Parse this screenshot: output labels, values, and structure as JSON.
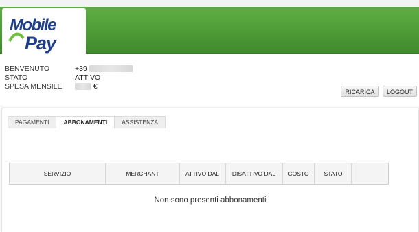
{
  "brand": {
    "logo_line1": "Mobile",
    "logo_line2": "Pay",
    "header_color": "#4e9b36"
  },
  "info": {
    "rows": [
      {
        "label": "BENVENUTO",
        "value": "+39"
      },
      {
        "label": "STATO",
        "value": "ATTIVO"
      },
      {
        "label": "SPESA MENSILE",
        "value": "€"
      }
    ]
  },
  "actions": {
    "ricarica": "RICARICA",
    "logout": "LOGOUT"
  },
  "tabs": [
    {
      "label": "PAGAMENTI",
      "active": false
    },
    {
      "label": "ABBONAMENTI",
      "active": true
    },
    {
      "label": "ASSISTENZA",
      "active": false
    }
  ],
  "table": {
    "headers": [
      "SERVIZIO",
      "MERCHANT",
      "ATTIVO DAL",
      "DISATTIVO DAL",
      "COSTO",
      "STATO",
      ""
    ],
    "empty_message": "Non sono presenti abbonamenti"
  }
}
